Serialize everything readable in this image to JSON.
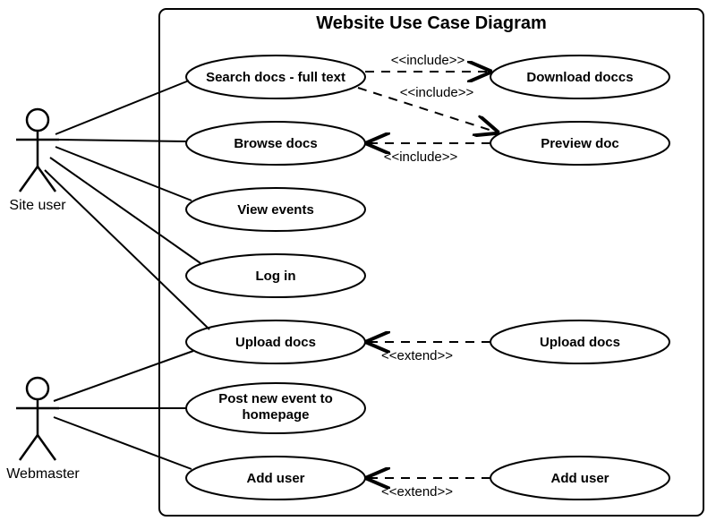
{
  "title": "Website Use Case Diagram",
  "actors": {
    "site_user": "Site user",
    "webmaster": "Webmaster"
  },
  "usecases": {
    "search": "Search docs - full text",
    "browse": "Browse docs",
    "view_ev": "View events",
    "login": "Log in",
    "upload": "Upload docs",
    "post_ev": "Post new event to homepage",
    "adduser": "Add user",
    "download": "Download doccs",
    "preview": "Preview doc",
    "upload2": "Upload docs",
    "adduser2": "Add user"
  },
  "stereotypes": {
    "include": "<<include>>",
    "extend": "<<extend>>"
  }
}
